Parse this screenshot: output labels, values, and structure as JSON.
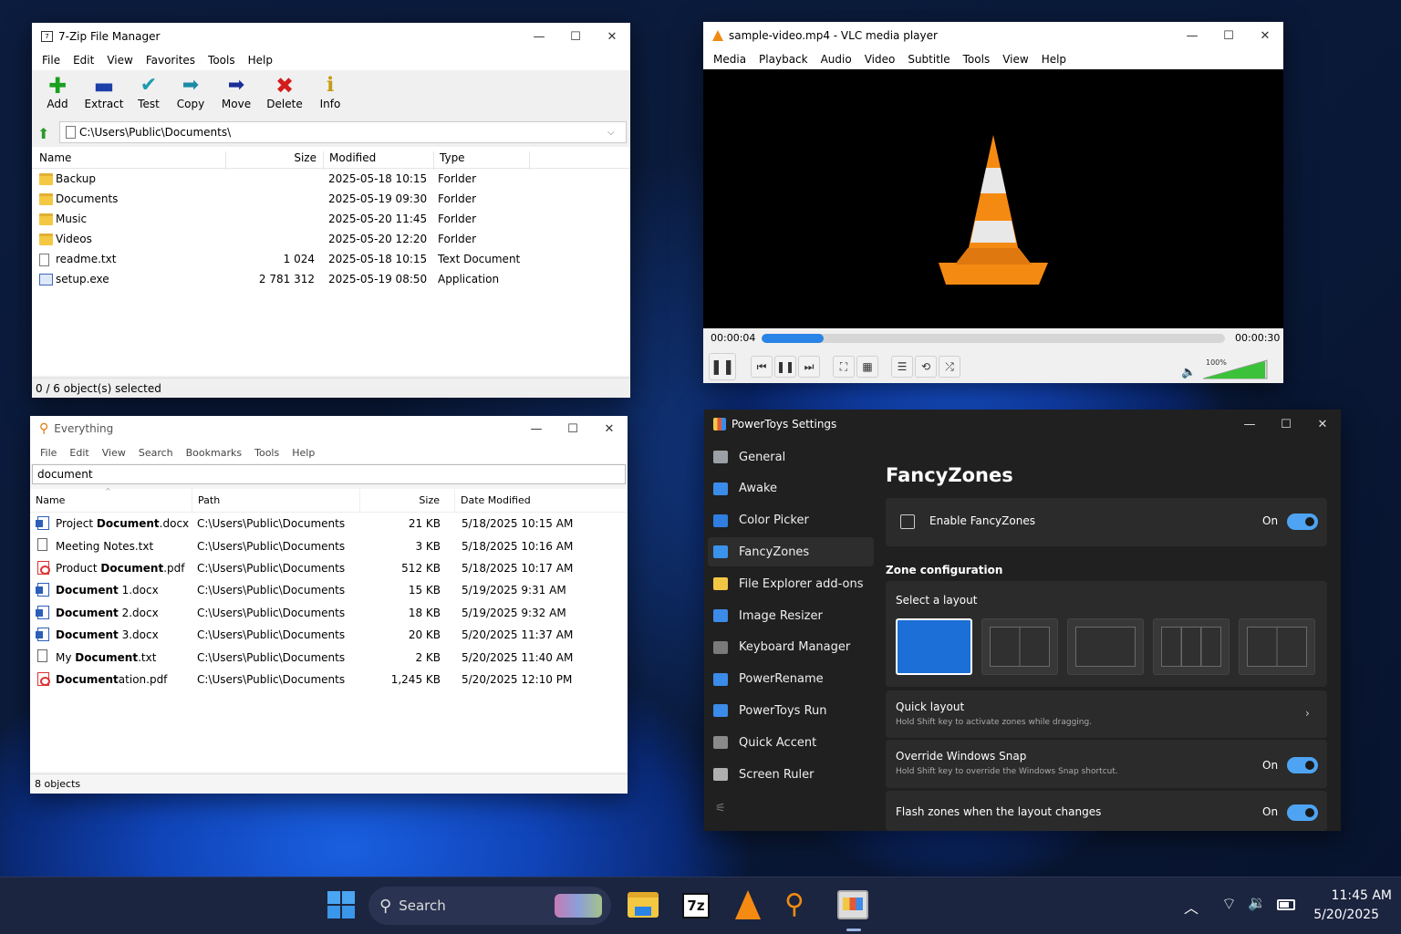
{
  "zip": {
    "title": "7-Zip File Manager",
    "menu": [
      "File",
      "Edit",
      "View",
      "Favorites",
      "Tools",
      "Help"
    ],
    "toolbar": [
      "Add",
      "Extract",
      "Test",
      "Copy",
      "Move",
      "Delete",
      "Info"
    ],
    "path": "C:\\Users\\Public\\Documents\\",
    "columns": [
      "Name",
      "Size",
      "Modified",
      "Type"
    ],
    "rows": [
      {
        "icon": "folder",
        "name": "Backup",
        "size": "",
        "modified": "2025-05-18 10:15",
        "type": "Forlder"
      },
      {
        "icon": "folder",
        "name": "Documents",
        "size": "",
        "modified": "2025-05-19 09:30",
        "type": "Forlder"
      },
      {
        "icon": "folder",
        "name": "Music",
        "size": "",
        "modified": "2025-05-20 11:45",
        "type": "Forlder"
      },
      {
        "icon": "folder",
        "name": "Videos",
        "size": "",
        "modified": "2025-05-20 12:20",
        "type": "Forlder"
      },
      {
        "icon": "file",
        "name": "readme.txt",
        "size": "1 024",
        "modified": "2025-05-18 10:15",
        "type": "Text Document"
      },
      {
        "icon": "exe",
        "name": "setup.exe",
        "size": "2 781 312",
        "modified": "2025-05-19 08:50",
        "type": "Application"
      }
    ],
    "status": "0 / 6 object(s) selected"
  },
  "vlc": {
    "title": "sample-video.mp4 - VLC media player",
    "menu": [
      "Media",
      "Playback",
      "Audio",
      "Video",
      "Subtitle",
      "Tools",
      "View",
      "Help"
    ],
    "elapsed": "00:00:04",
    "total": "00:00:30",
    "progress": 0.133,
    "volume": "100%"
  },
  "everything": {
    "title": "Everything",
    "menu": [
      "File",
      "Edit",
      "View",
      "Search",
      "Bookmarks",
      "Tools",
      "Help"
    ],
    "search": "document",
    "columns": [
      "Name",
      "Path",
      "Size",
      "Date Modified"
    ],
    "rows": [
      {
        "icon": "docx",
        "pre": "Project ",
        "hl": "Document",
        "post": ".docx",
        "path": "C:\\Users\\Public\\Documents",
        "size": "21 KB",
        "date": "5/18/2025 10:15 AM"
      },
      {
        "icon": "txt",
        "pre": "Meeting Notes.txt",
        "hl": "",
        "post": "",
        "path": "C:\\Users\\Public\\Documents",
        "size": "3 KB",
        "date": "5/18/2025 10:16 AM"
      },
      {
        "icon": "pdf",
        "pre": "Product ",
        "hl": "Document",
        "post": ".pdf",
        "path": "C:\\Users\\Public\\Documents",
        "size": "512 KB",
        "date": "5/18/2025 10:17 AM"
      },
      {
        "icon": "docx",
        "pre": "",
        "hl": "Document",
        "post": " 1.docx",
        "path": "C:\\Users\\Public\\Documents",
        "size": "15 KB",
        "date": "5/19/2025 9:31 AM"
      },
      {
        "icon": "docx",
        "pre": "",
        "hl": "Document",
        "post": " 2.docx",
        "path": "C:\\Users\\Public\\Documents",
        "size": "18 KB",
        "date": "5/19/2025 9:32 AM"
      },
      {
        "icon": "docx",
        "pre": "",
        "hl": "Document",
        "post": " 3.docx",
        "path": "C:\\Users\\Public\\Documents",
        "size": "20 KB",
        "date": "5/20/2025 11:37 AM"
      },
      {
        "icon": "txt",
        "pre": "My ",
        "hl": "Document",
        "post": ".txt",
        "path": "C:\\Users\\Public\\Documents",
        "size": "2 KB",
        "date": "5/20/2025 11:40 AM"
      },
      {
        "icon": "pdf",
        "pre": "",
        "hl": "Document",
        "post": "ation.pdf",
        "path": "C:\\Users\\Public\\Documents",
        "size": "1,245 KB",
        "date": "5/20/2025 12:10 PM"
      }
    ],
    "status": "8 objects"
  },
  "powertoys": {
    "title": "PowerToys Settings",
    "nav": [
      {
        "label": "General",
        "color": "#9aa0a6"
      },
      {
        "label": "Awake",
        "color": "#3b8be8"
      },
      {
        "label": "Color Picker",
        "color": "#2f7ee0"
      },
      {
        "label": "FancyZones",
        "color": "#3a92ea"
      },
      {
        "label": "File Explorer add-ons",
        "color": "#f2c744"
      },
      {
        "label": "Image Resizer",
        "color": "#3b8be8"
      },
      {
        "label": "Keyboard Manager",
        "color": "#7a7a7a"
      },
      {
        "label": "PowerRename",
        "color": "#3b8be8"
      },
      {
        "label": "PowerToys Run",
        "color": "#3b8be8"
      },
      {
        "label": "Quick Accent",
        "color": "#8a8a8a"
      },
      {
        "label": "Screen Ruler",
        "color": "#b0b0b0"
      }
    ],
    "heading": "FancyZones",
    "enable_label": "Enable FancyZones",
    "enable_state": "On",
    "zone_section": "Zone configuration",
    "select_layout": "Select a layout",
    "quick_layout": "Quick layout",
    "quick_layout_desc": "Hold Shift key to activate zones while dragging.",
    "override_label": "Override Windows Snap",
    "override_desc": "Hold Shift key to override the Windows Snap shortcut.",
    "override_state": "On",
    "flash_label": "Flash zones when the layout changes",
    "flash_state": "On"
  },
  "taskbar": {
    "search": "Search",
    "time": "11:45 AM",
    "date": "5/20/2025",
    "zip_label": "7z"
  }
}
